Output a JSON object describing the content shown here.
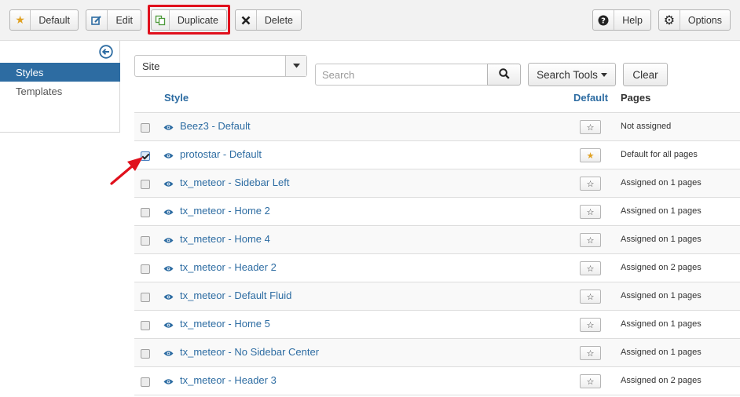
{
  "toolbar": {
    "default_label": "Default",
    "edit_label": "Edit",
    "duplicate_label": "Duplicate",
    "delete_label": "Delete",
    "help_label": "Help",
    "options_label": "Options"
  },
  "sidebar": {
    "items": [
      {
        "label": "Styles",
        "active": true
      },
      {
        "label": "Templates",
        "active": false
      }
    ]
  },
  "filters": {
    "client_value": "Site",
    "search_placeholder": "Search",
    "search_tools_label": "Search Tools",
    "clear_label": "Clear"
  },
  "table": {
    "headers": {
      "style": "Style",
      "default": "Default",
      "pages": "Pages"
    },
    "rows": [
      {
        "name": "Beez3 - Default",
        "checked": false,
        "is_default": false,
        "pages": "Not assigned"
      },
      {
        "name": "protostar - Default",
        "checked": true,
        "is_default": true,
        "pages": "Default for all pages"
      },
      {
        "name": "tx_meteor - Sidebar Left",
        "checked": false,
        "is_default": false,
        "pages": "Assigned on 1 pages"
      },
      {
        "name": "tx_meteor - Home 2",
        "checked": false,
        "is_default": false,
        "pages": "Assigned on 1 pages"
      },
      {
        "name": "tx_meteor - Home 4",
        "checked": false,
        "is_default": false,
        "pages": "Assigned on 1 pages"
      },
      {
        "name": "tx_meteor - Header 2",
        "checked": false,
        "is_default": false,
        "pages": "Assigned on 2 pages"
      },
      {
        "name": "tx_meteor - Default Fluid",
        "checked": false,
        "is_default": false,
        "pages": "Assigned on 1 pages"
      },
      {
        "name": "tx_meteor - Home 5",
        "checked": false,
        "is_default": false,
        "pages": "Assigned on 1 pages"
      },
      {
        "name": "tx_meteor - No Sidebar Center",
        "checked": false,
        "is_default": false,
        "pages": "Assigned on 1 pages"
      },
      {
        "name": "tx_meteor - Header 3",
        "checked": false,
        "is_default": false,
        "pages": "Assigned on 2 pages"
      }
    ]
  },
  "colors": {
    "accent": "#2d6ca2",
    "highlight": "#e0101c",
    "default_star": "#e0a122",
    "annotation_arrow": "#e0101c"
  },
  "icons": {
    "default": "star-icon",
    "edit": "edit-icon",
    "duplicate": "copy-icon",
    "delete": "close-icon",
    "help": "question-circle-icon",
    "options": "gear-icon",
    "collapse": "arrow-left-circle-icon",
    "search": "search-icon",
    "preview": "eye-icon"
  }
}
